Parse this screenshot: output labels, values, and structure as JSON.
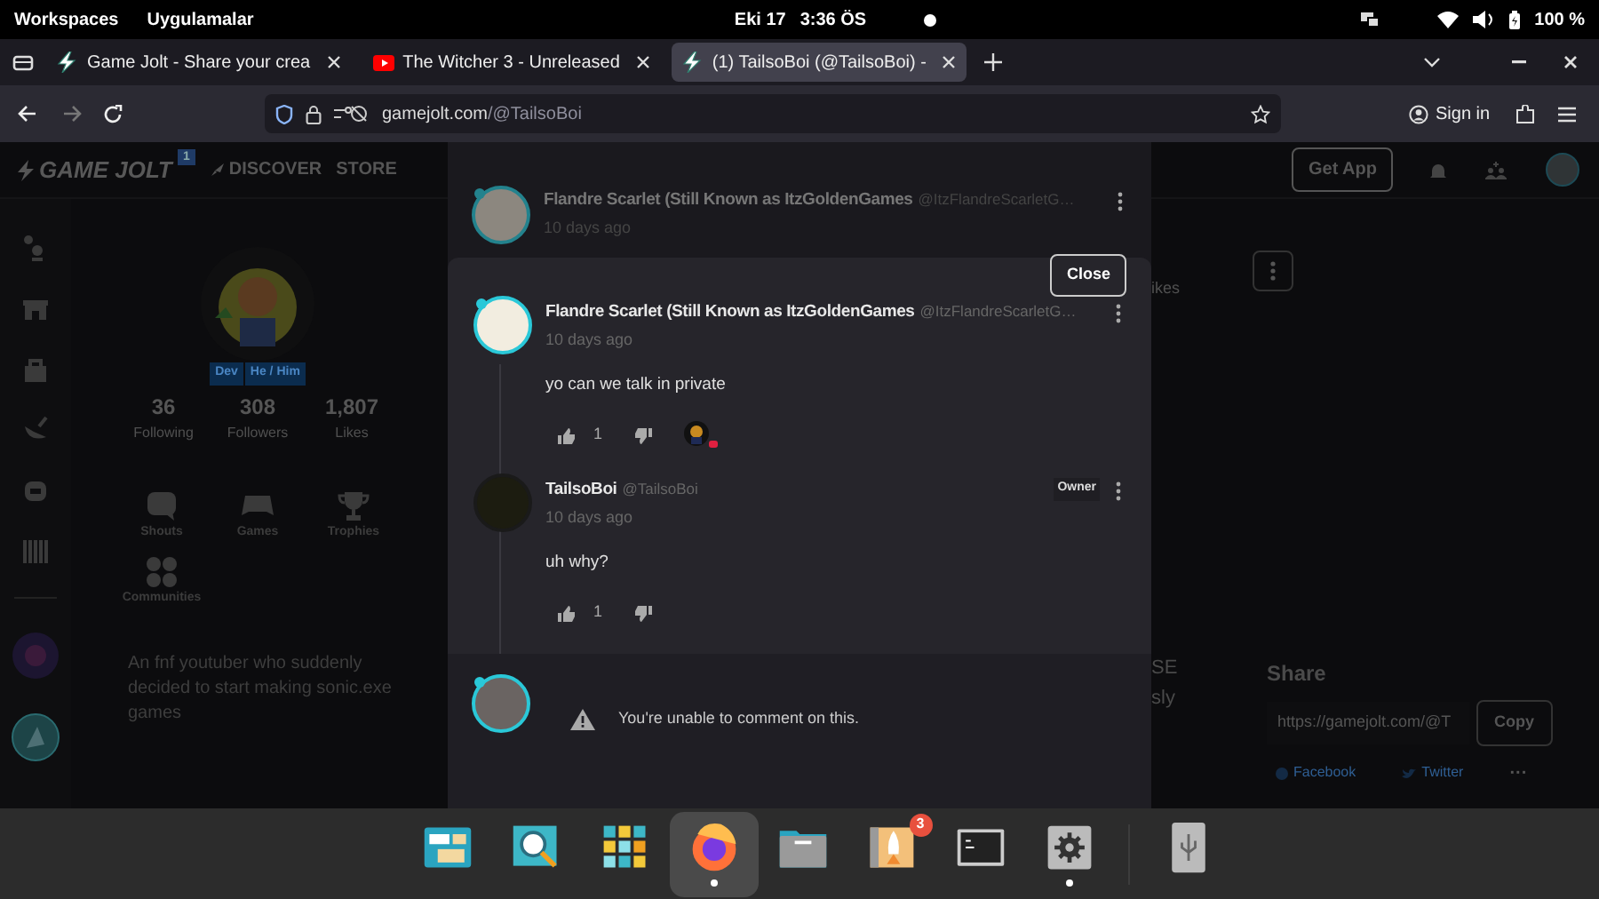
{
  "system_bar": {
    "menus": [
      "Workspaces",
      "Uygulamalar"
    ],
    "date": "Eki 17",
    "time": "3:36 ÖS",
    "battery": "100 %"
  },
  "browser": {
    "tabs": [
      {
        "title": "Game Jolt - Share your crea",
        "kind": "gamejolt",
        "selected": false
      },
      {
        "title": "The Witcher 3 - Unreleased",
        "kind": "video",
        "selected": false
      },
      {
        "title": "(1) TailsoBoi (@TailsoBoi) -",
        "kind": "gamejolt",
        "selected": true
      }
    ],
    "url_host": "gamejolt.com",
    "url_path": "/@TailsoBoi",
    "sign_in": "Sign in"
  },
  "site_nav": {
    "logo": "GAME JOLT",
    "notification_count": "1",
    "links": [
      "DISCOVER",
      "STORE"
    ],
    "get_app": "Get App"
  },
  "profile": {
    "tags": [
      "Dev",
      "He / Him"
    ],
    "stats": [
      {
        "value": "36",
        "label": "Following"
      },
      {
        "value": "308",
        "label": "Followers"
      },
      {
        "value": "1,807",
        "label": "Likes"
      }
    ],
    "sections": [
      {
        "kind": "shouts",
        "label": "Shouts"
      },
      {
        "kind": "games",
        "label": "Games"
      },
      {
        "kind": "trophies",
        "label": "Trophies"
      },
      {
        "kind": "communities",
        "label": "Communities"
      }
    ],
    "bio": "An fnf youtuber who suddenly decided to start making sonic.exe games"
  },
  "middle_fragments": [
    "ikes",
    "SE",
    "sly"
  ],
  "share": {
    "title": "Share",
    "url": "https://gamejolt.com/@T",
    "copy": "Copy",
    "links": [
      "Facebook",
      "Twitter"
    ],
    "more": "···"
  },
  "comments_modal": {
    "parent": {
      "name": "Flandre Scarlet (Still Known as ItzGoldenGames",
      "handle": "@ItzFlandreScarletG…",
      "time": "10 days ago"
    },
    "close": "Close",
    "replies": [
      {
        "name": "Flandre Scarlet (Still Known as ItzGoldenGames",
        "handle": "@ItzFlandreScarletG…",
        "time": "10 days ago",
        "body": "yo can we talk in private",
        "likes": "1",
        "reacted": true,
        "ring": true
      },
      {
        "name": "TailsoBoi",
        "handle": "@TailsoBoi",
        "time": "10 days ago",
        "body": "uh why?",
        "likes": "1",
        "badge": "Owner",
        "reacted": false,
        "ring": false
      }
    ],
    "notice": "You're unable to comment on this."
  },
  "dock": [
    {
      "kind": "windows",
      "running": false,
      "selected": false
    },
    {
      "kind": "search",
      "running": false,
      "selected": false
    },
    {
      "kind": "apps",
      "running": false,
      "selected": false
    },
    {
      "kind": "firefox",
      "running": true,
      "selected": true
    },
    {
      "kind": "files",
      "running": false,
      "selected": false
    },
    {
      "kind": "launcher",
      "running": false,
      "selected": false,
      "badge": "3"
    },
    {
      "kind": "terminal",
      "running": false,
      "selected": false
    },
    {
      "kind": "settings",
      "running": true,
      "selected": false
    },
    {
      "kind": "usb",
      "running": false,
      "selected": false
    }
  ]
}
